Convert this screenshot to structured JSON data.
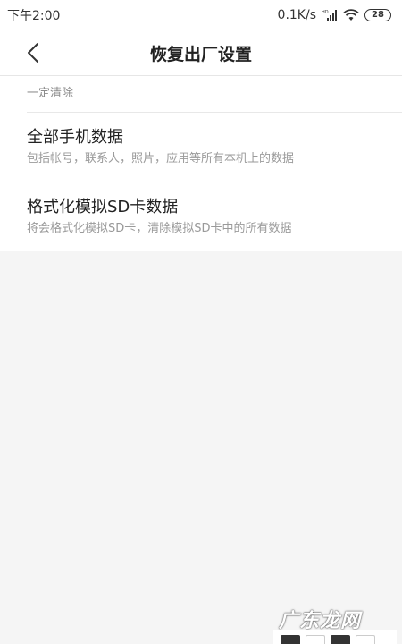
{
  "status_bar": {
    "time": "下午2:00",
    "network_speed": "0.1K/s",
    "signal_badge": "HD",
    "battery_level": "28"
  },
  "header": {
    "title": "恢复出厂设置"
  },
  "section": {
    "label": "一定清除"
  },
  "options": [
    {
      "title": "全部手机数据",
      "description": "包括帐号，联系人，照片，应用等所有本机上的数据"
    },
    {
      "title": "格式化模拟SD卡数据",
      "description": "将会格式化模拟SD卡，清除模拟SD卡中的所有数据"
    }
  ],
  "watermark": {
    "text": "广东龙网"
  },
  "colors": {
    "background": "#f5f5f5",
    "surface": "#ffffff",
    "primary_text": "#222222",
    "secondary_text": "#9a9a9a"
  }
}
